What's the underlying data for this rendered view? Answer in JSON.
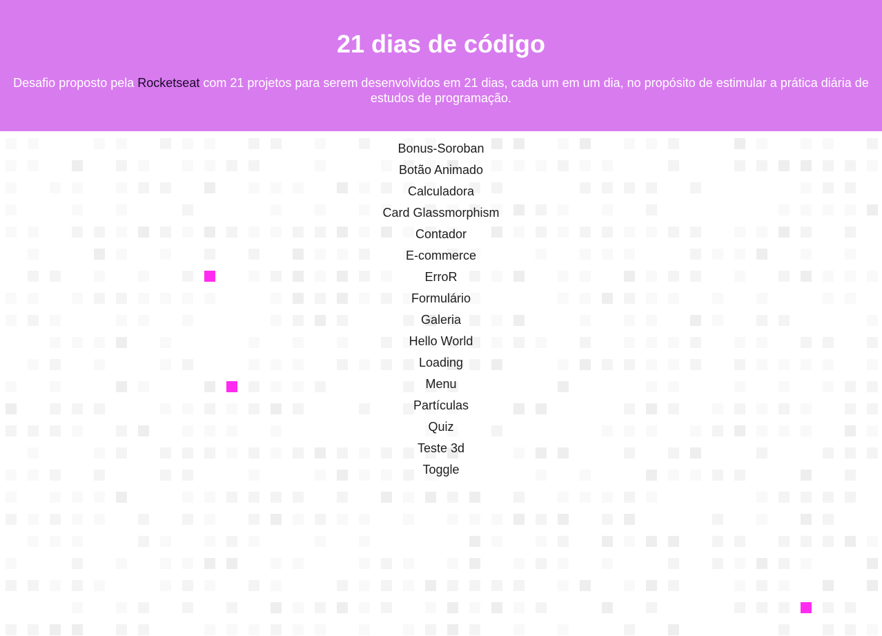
{
  "header": {
    "title": "21 dias de código",
    "description_before": "Desafio proposto pela ",
    "description_link": "Rocketseat",
    "description_after": " com 21 projetos para serem desenvolvidos em 21 dias, cada um em um dia, no propósito de estimular a prática diária de estudos de programação."
  },
  "projects": [
    "Bonus-Soroban",
    "Botão Animado",
    "Calculadora",
    "Card Glassmorphism",
    "Contador",
    "E-commerce",
    "ErroR",
    "Formulário",
    "Galeria",
    "Hello World",
    "Loading",
    "Menu",
    "Partículas",
    "Quiz",
    "Teste 3d",
    "Toggle"
  ],
  "colors": {
    "header_bg": "#d87bef",
    "highlight_square": "#ff2bf0",
    "grid_square": "#f1f1f1"
  }
}
